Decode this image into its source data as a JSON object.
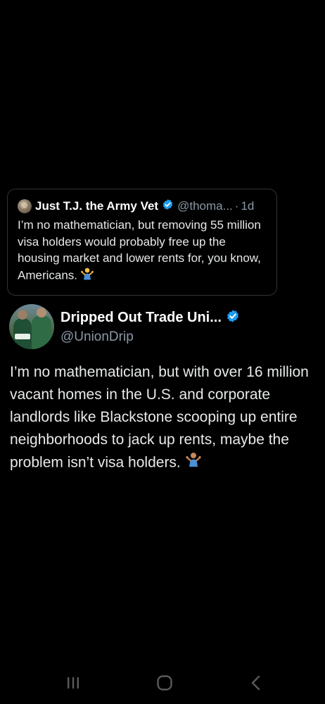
{
  "quoted_tweet": {
    "author_name": "Just T.J. the Army Vet",
    "handle": "@thoma...",
    "separator": "·",
    "time_ago": "1d",
    "text": "I’m no mathematician, but removing 55 million visa holders would probably free up the housing market and lower rents for, you know, Americans."
  },
  "main_tweet": {
    "author_name": "Dripped Out Trade Uni...",
    "handle": "@UnionDrip",
    "text": "I’m no mathematician, but with over 16 million vacant homes in the U.S. and corporate landlords like Blackstone scooping up entire neighborhoods to jack up rents, maybe the problem isn’t visa holders."
  },
  "icons": {
    "verified": "verified-badge-icon",
    "shrug": "person-shrugging-emoji",
    "nav_recent": "recent-apps-icon",
    "nav_home": "home-icon",
    "nav_back": "back-icon"
  },
  "colors": {
    "background": "#000000",
    "verified_blue": "#1d9bf0",
    "secondary_text": "#8b98a5",
    "primary_text": "#e7e9ea",
    "card_border": "#2f3336",
    "nav_icon": "#5a5a5a"
  }
}
